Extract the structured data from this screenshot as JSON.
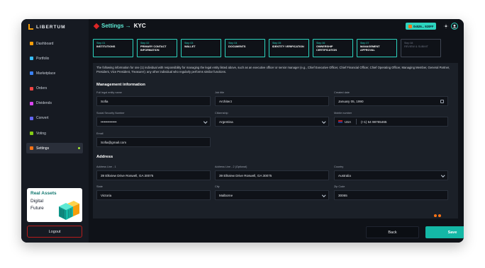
{
  "app": {
    "logo_text": "LIBERTUM"
  },
  "sidebar": {
    "items": [
      {
        "label": "Dashboard",
        "icon": "dashboard-icon",
        "color": "#f59e0b",
        "active": false
      },
      {
        "label": "Portfolio",
        "icon": "portfolio-icon",
        "color": "#38bdf8",
        "active": false
      },
      {
        "label": "Marketplace",
        "icon": "marketplace-icon",
        "color": "#3b82f6",
        "active": false
      },
      {
        "label": "Orders",
        "icon": "orders-icon",
        "color": "#ef4444",
        "active": false
      },
      {
        "label": "Dividends",
        "icon": "dividends-icon",
        "color": "#d946ef",
        "active": false
      },
      {
        "label": "Convert",
        "icon": "convert-icon",
        "color": "#6366f1",
        "active": false
      },
      {
        "label": "Voting",
        "icon": "voting-icon",
        "color": "#84cc16",
        "active": false
      },
      {
        "label": "Settings",
        "icon": "settings-icon",
        "color": "#f97316",
        "active": true
      }
    ],
    "promo": {
      "line1": "Real Assets",
      "line2": "Digital",
      "line3": "Future"
    },
    "logout_label": "Logout"
  },
  "header": {
    "title_prefix": "Settings →",
    "title_suffix": "KYC",
    "wallet_label": "0x526... 920FF"
  },
  "steps": [
    {
      "num": "Step 01",
      "label": "Institutions",
      "state": "done"
    },
    {
      "num": "Step 02",
      "label": "Primary contact information",
      "state": "done"
    },
    {
      "num": "Step 03",
      "label": "Wallet",
      "state": "done"
    },
    {
      "num": "Step 04",
      "label": "Documents",
      "state": "done"
    },
    {
      "num": "Step 05",
      "label": "Identity verification",
      "state": "done"
    },
    {
      "num": "Step 06",
      "label": "Ownership certification",
      "state": "done"
    },
    {
      "num": "Step 07",
      "label": "Management approval",
      "state": "current"
    },
    {
      "num": "Step 08",
      "label": "Review & submit",
      "state": "pending"
    }
  ],
  "form": {
    "intro": "The following information for one (1) individual with responsibility for managing the legal entity listed above, such as an executive officer or senior manager (e.g., Chief Executive Officer, Chief Financial Officer, Chief Operating Officer, Managing Member, General Partner, President, Vice President, Treasurer); any other individual who regularly performs similar functions.",
    "management_title": "Management information",
    "full_name": {
      "label": "Full legal entity name",
      "value": "Sofia"
    },
    "job_title": {
      "label": "Job title",
      "value": "Architect"
    },
    "created_date": {
      "label": "Created date",
      "value": "January 05, 1990"
    },
    "ssn": {
      "label": "Social Security Number",
      "value": "••••••••••••••"
    },
    "citizenship": {
      "label": "Citizenship",
      "value": "Argentina"
    },
    "mobile": {
      "label": "Mobile number",
      "country": "USA",
      "value": "(+1) 54 98765465"
    },
    "email": {
      "label": "Email",
      "value": "Sofia@gmail.com"
    },
    "address_title": "Address",
    "address1": {
      "label": "Address Line - 1",
      "value": "39 Elkview Drive Roswell, GA 30075"
    },
    "address2": {
      "label": "Address Line - 2 (Optional)",
      "value": "39 Elkview Drive Roswell, GA 30075"
    },
    "country": {
      "label": "Country",
      "value": "Australia"
    },
    "state": {
      "label": "State",
      "value": "Victoria"
    },
    "city": {
      "label": "City",
      "value": "Malborne"
    },
    "zip": {
      "label": "Zip Code",
      "value": "30065"
    }
  },
  "footer": {
    "back_label": "Back",
    "save_label": "Save"
  },
  "colors": {
    "accent": "#2dd4bf",
    "save": "#14b8a6",
    "logout_border": "#b91c1c",
    "background": "#0f1218"
  }
}
